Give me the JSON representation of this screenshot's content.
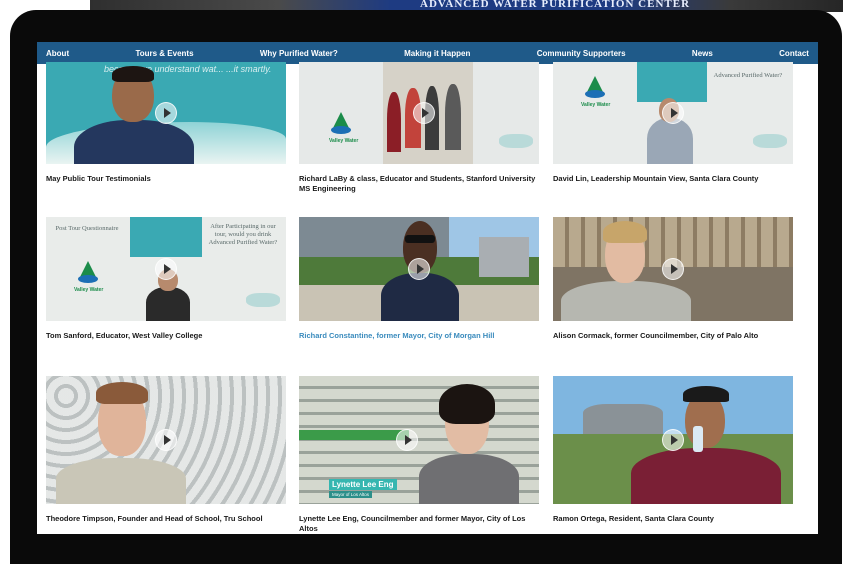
{
  "background": {
    "sign_text": "ADVANCED WATER PURIFICATION CENTER"
  },
  "nav": {
    "items": [
      {
        "label": "About"
      },
      {
        "label": "Tours & Events"
      },
      {
        "label": "Why Purified Water?"
      },
      {
        "label": "Making it Happen"
      },
      {
        "label": "Community Supporters"
      },
      {
        "label": "News"
      },
      {
        "label": "Contact"
      }
    ]
  },
  "videos": [
    {
      "caption": "May Public Tour Testimonials",
      "quote": "because we understand wat... ...it smartly."
    },
    {
      "caption": "Richard LaBy & class, Educator and Students, Stanford University MS Engineering",
      "logo": "Valley Water"
    },
    {
      "caption": "David Lin, Leadership Mountain View, Santa Clara County",
      "logo": "Valley Water",
      "sign": "Advanced Purified Water?"
    },
    {
      "caption": "Tom Sanford, Educator, West Valley College",
      "logo": "Valley Water",
      "sign_left": "Post Tour Questionnaire",
      "sign_right": "After Participating in our tour, would you drink Advanced Purified Water?"
    },
    {
      "caption": "Richard Constantine, former Mayor, City of Morgan Hill"
    },
    {
      "caption": "Alison Cormack, former Councilmember, City of Palo Alto"
    },
    {
      "caption": "Theodore Timpson, Founder and Head of School, Tru School"
    },
    {
      "caption": "Lynette Lee Eng, Councilmember and former Mayor, City of Los Altos",
      "banner": "Lynette Lee Eng",
      "banner_sub": "Mayor of Los Altos"
    },
    {
      "caption": "Ramon Ortega, Resident, Santa Clara County"
    }
  ],
  "colors": {
    "nav_bg": "#1f5a89",
    "link": "#3a8bbd",
    "frame": "#0a0a0a"
  }
}
